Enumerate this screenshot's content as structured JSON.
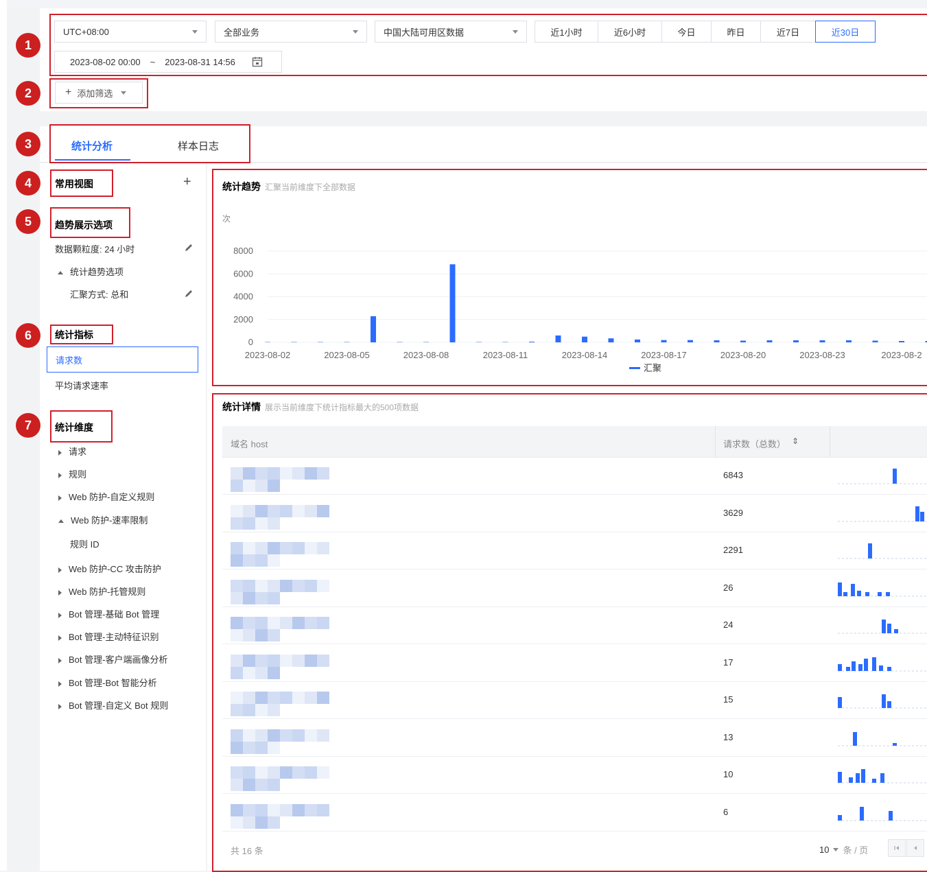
{
  "annotations": [
    "1",
    "2",
    "3",
    "4",
    "5",
    "6",
    "7"
  ],
  "filters": {
    "timezone": "UTC+08:00",
    "business": "全部业务",
    "region": "中国大陆可用区数据",
    "quick_ranges": [
      "近1小时",
      "近6小时",
      "今日",
      "昨日",
      "近7日",
      "近30日"
    ],
    "active_range": "近30日",
    "start": "2023-08-02 00:00",
    "sep": "~",
    "end": "2023-08-31 14:56",
    "add_filter": "添加筛选"
  },
  "tabs": [
    "统计分析",
    "样本日志"
  ],
  "sidebar": {
    "common_views": "常用视图",
    "trend_options": "趋势展示选项",
    "granularity": "数据颗粒度: 24 小时",
    "trend_sub": "统计趋势选项",
    "aggregation": "汇聚方式: 总和",
    "metrics_title": "统计指标",
    "metrics": [
      "请求数",
      "平均请求速率"
    ],
    "dimensions_title": "统计维度",
    "dimensions": [
      {
        "label": "请求",
        "expanded": false
      },
      {
        "label": "规则",
        "expanded": false
      },
      {
        "label": "Web 防护-自定义规则",
        "expanded": false
      },
      {
        "label": "Web 防护-速率限制",
        "expanded": true
      },
      {
        "label": "规则 ID",
        "child": true
      },
      {
        "label": "Web 防护-CC 攻击防护",
        "expanded": false
      },
      {
        "label": "Web 防护-托管规则",
        "expanded": false
      },
      {
        "label": "Bot 管理-基础 Bot 管理",
        "expanded": false
      },
      {
        "label": "Bot 管理-主动特征识别",
        "expanded": false
      },
      {
        "label": "Bot 管理-客户端画像分析",
        "expanded": false
      },
      {
        "label": "Bot 管理-Bot 智能分析",
        "expanded": false
      },
      {
        "label": "Bot 管理-自定义 Bot 规则",
        "expanded": false
      }
    ]
  },
  "trend": {
    "title": "统计趋势",
    "subtitle": "汇聚当前维度下全部数据",
    "unit": "次",
    "legend": "汇聚"
  },
  "chart_data": {
    "type": "bar",
    "y_ticks": [
      0,
      2000,
      4000,
      6000,
      8000
    ],
    "ylim": [
      0,
      8000
    ],
    "x_tick_labels": [
      "2023-08-02",
      "2023-08-05",
      "2023-08-08",
      "2023-08-11",
      "2023-08-14",
      "2023-08-17",
      "2023-08-20",
      "2023-08-23",
      "2023-08-2"
    ],
    "series": [
      {
        "name": "汇聚",
        "values": [
          20,
          15,
          15,
          15,
          2291,
          10,
          15,
          6843,
          10,
          10,
          60,
          600,
          500,
          350,
          250,
          200,
          200,
          180,
          150,
          180,
          180,
          180,
          180,
          150,
          120,
          120,
          120
        ]
      }
    ]
  },
  "details": {
    "title": "统计详情",
    "subtitle": "展示当前维度下统计指标最大的500项数据",
    "col_host": "域名 host",
    "col_count": "请求数（总数）",
    "sort_icon": "⇕",
    "rows": [
      "6843",
      "3629",
      "2291",
      "26",
      "24",
      "17",
      "15",
      "13",
      "10",
      "6"
    ],
    "total": "共 16 条",
    "page_size": "10",
    "per_page": "条 / 页"
  },
  "colors": {
    "accent": "#2b6cff",
    "annotation": "#cc1f1f"
  }
}
